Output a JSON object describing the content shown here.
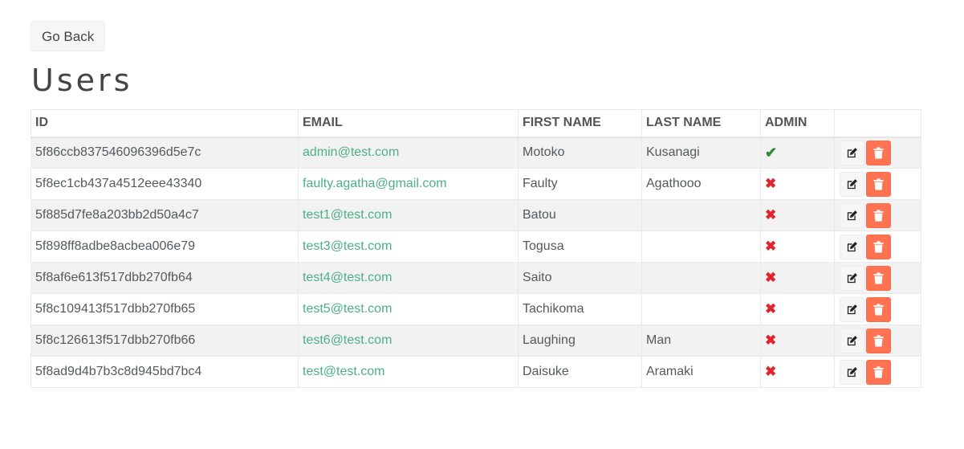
{
  "back_button": {
    "label": "Go Back"
  },
  "title": "Users",
  "colors": {
    "email_link": "#4caf88",
    "admin_true": "#2e8b2e",
    "admin_false": "#e0242b",
    "delete_button": "#ff7352"
  },
  "table": {
    "headers": [
      "ID",
      "EMAIL",
      "FIRST NAME",
      "LAST NAME",
      "ADMIN",
      ""
    ],
    "rows": [
      {
        "id": "5f86ccb837546096396d5e7c",
        "email": "admin@test.com",
        "first": "Motoko",
        "last": "Kusanagi",
        "admin": "✔",
        "admin_icon": "check-icon"
      },
      {
        "id": "5f8ec1cb437a4512eee43340",
        "email": "faulty.agatha@gmail.com",
        "first": "Faulty",
        "last": "Agathooo",
        "admin": "✖",
        "admin_icon": "cross-icon"
      },
      {
        "id": "5f885d7fe8a203bb2d50a4c7",
        "email": "test1@test.com",
        "first": "Batou",
        "last": "",
        "admin": "✖",
        "admin_icon": "cross-icon"
      },
      {
        "id": "5f898ff8adbe8acbea006e79",
        "email": "test3@test.com",
        "first": "Togusa",
        "last": "",
        "admin": "✖",
        "admin_icon": "cross-icon"
      },
      {
        "id": "5f8af6e613f517dbb270fb64",
        "email": "test4@test.com",
        "first": "Saito",
        "last": "",
        "admin": "✖",
        "admin_icon": "cross-icon"
      },
      {
        "id": "5f8c109413f517dbb270fb65",
        "email": "test5@test.com",
        "first": "Tachikoma",
        "last": "",
        "admin": "✖",
        "admin_icon": "cross-icon"
      },
      {
        "id": "5f8c126613f517dbb270fb66",
        "email": "test6@test.com",
        "first": "Laughing",
        "last": "Man",
        "admin": "✖",
        "admin_icon": "cross-icon"
      },
      {
        "id": "5f8ad9d4b7b3c8d945bd7bc4",
        "email": "test@test.com",
        "first": "Daisuke",
        "last": "Aramaki",
        "admin": "✖",
        "admin_icon": "cross-icon"
      }
    ]
  }
}
